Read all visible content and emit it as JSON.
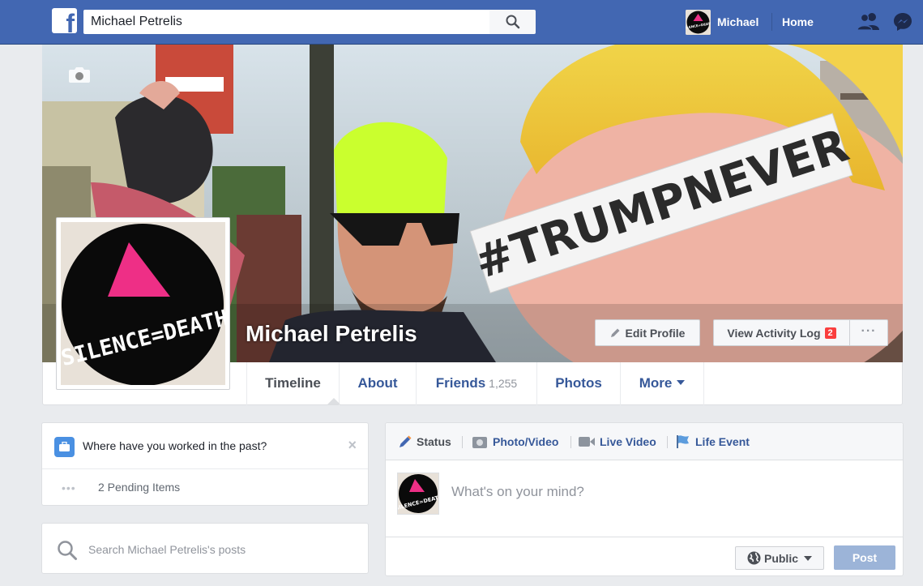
{
  "topbar": {
    "logo": "f",
    "search_value": "Michael Petrelis",
    "user_name": "Michael",
    "home_label": "Home",
    "icons": [
      "facebook-logo-icon",
      "search-icon",
      "friend-requests-icon",
      "messenger-icon"
    ]
  },
  "profile": {
    "name": "Michael Petrelis",
    "cover_text": "#TRUMPNEVER",
    "avatar_text": "SILENCE=DEATH",
    "edit_profile_label": "Edit Profile",
    "activity_log_label": "View Activity Log",
    "activity_log_count": "2",
    "more_label": "···"
  },
  "tabs": [
    {
      "label": "Timeline",
      "active": true
    },
    {
      "label": "About"
    },
    {
      "label": "Friends",
      "count": "1,255"
    },
    {
      "label": "Photos"
    },
    {
      "label": "More"
    }
  ],
  "work_prompt": {
    "question": "Where have you worked in the past?",
    "close": "×",
    "pending": "2 Pending Items"
  },
  "post_search": {
    "placeholder": "Search Michael Petrelis's posts"
  },
  "composer": {
    "tabs": [
      {
        "label": "Status",
        "icon": "pencil-icon"
      },
      {
        "label": "Photo/Video",
        "icon": "camera-icon"
      },
      {
        "label": "Live Video",
        "icon": "video-camera-icon"
      },
      {
        "label": "Life Event",
        "icon": "flag-icon"
      }
    ],
    "placeholder": "What's on your mind?",
    "audience_label": "Public",
    "post_label": "Post"
  },
  "colors": {
    "brand": "#4267b2",
    "link": "#365899",
    "badge": "#fa3e3e",
    "post_disabled": "#9cb4d8"
  }
}
